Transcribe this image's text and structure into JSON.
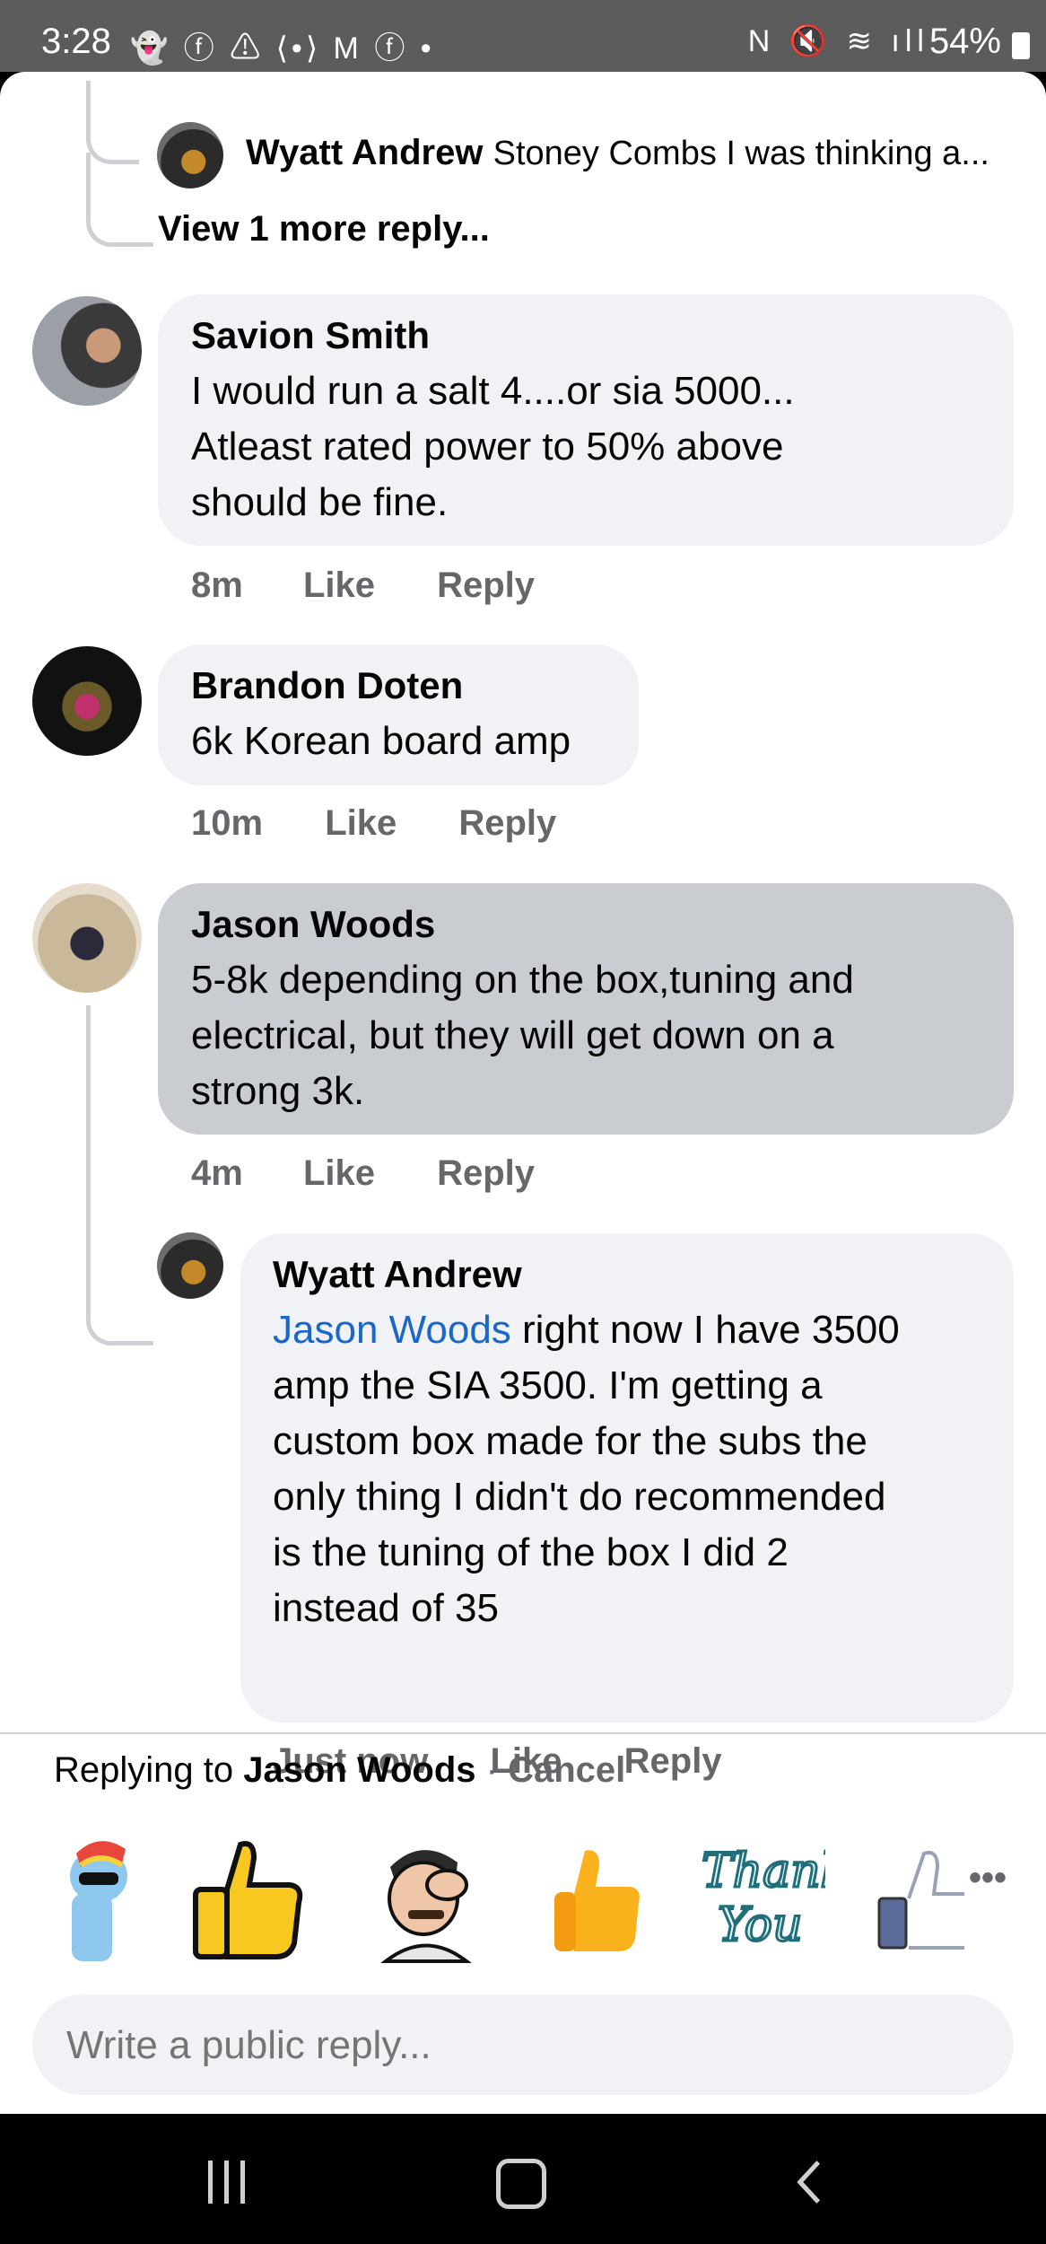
{
  "status_bar": {
    "time": "3:28",
    "battery": "54%"
  },
  "thread": {
    "top_reply": {
      "author": "Wyatt Andrew",
      "preview": "Stoney Combs I was thinking a..."
    },
    "view_more": "View 1 more reply..."
  },
  "comments": [
    {
      "author": "Savion Smith",
      "lines": [
        "I would run a salt 4....or sia 5000...",
        "Atleast rated power to 50% above",
        "should be fine."
      ],
      "time": "8m",
      "like": "Like",
      "reply": "Reply"
    },
    {
      "author": "Brandon Doten",
      "lines": [
        "6k Korean board amp"
      ],
      "time": "10m",
      "like": "Like",
      "reply": "Reply"
    },
    {
      "author": "Jason Woods",
      "lines": [
        "5-8k depending on the box,tuning and",
        "electrical, but they will get down on a",
        "strong 3k."
      ],
      "time": "4m",
      "like": "Like",
      "reply": "Reply"
    }
  ],
  "nested_reply": {
    "author": "Wyatt Andrew",
    "mention": "Jason Woods",
    "first_line_rest": " right now I have 3500",
    "lines": [
      "amp the SIA 3500. I'm getting a",
      "custom box made for the subs the",
      "only thing I didn't do recommended",
      "is the tuning of the box I did 2",
      "instead of 35"
    ],
    "time": "Just now",
    "like": "Like",
    "reply": "Reply"
  },
  "replying": {
    "prefix": "Replying to ",
    "name": "Jason Woods",
    "separator": " · ",
    "cancel": "Cancel"
  },
  "stickers": [
    "rainbow-pony-sunglasses-sticker",
    "thumbs-up-cartoon-sticker",
    "facepalm-man-sticker",
    "thumbs-up-emoji-sticker",
    "thank-you-script-sticker",
    "like-thumb-outline-sticker"
  ],
  "reply_input": {
    "placeholder": "Write a public reply..."
  },
  "colors": {
    "link": "#1b66c9",
    "bubble": "#f0f2f5",
    "selected_bubble": "#c9ccd1",
    "meta": "#65676b"
  }
}
